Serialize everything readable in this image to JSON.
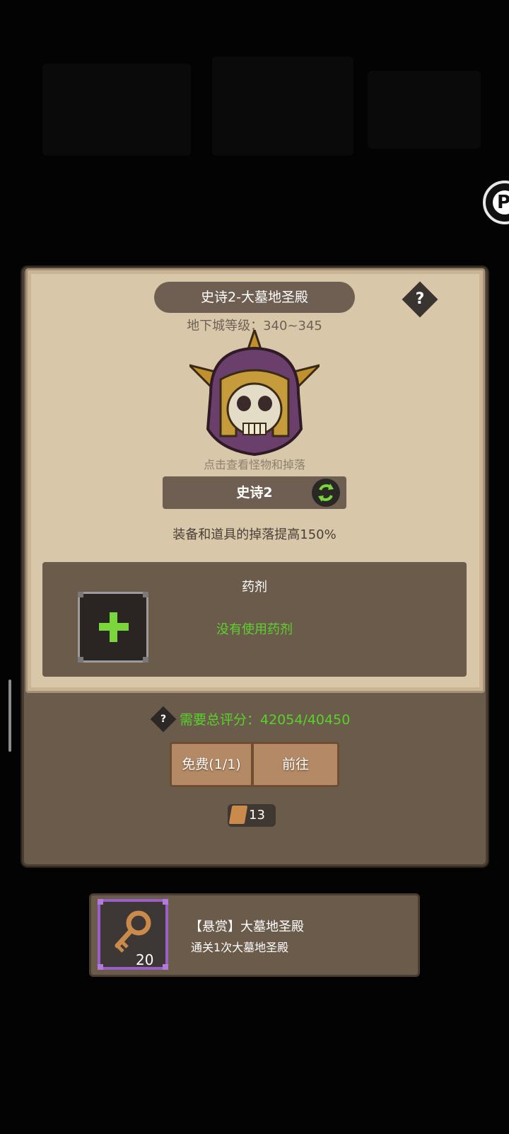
{
  "dungeon": {
    "title": "史诗2-大墓地圣殿",
    "level_text": "地下城等级：340~345",
    "monster_hint": "点击查看怪物和掉落",
    "difficulty": "史诗2",
    "drop_bonus": "装备和道具的掉落提高150%"
  },
  "potion": {
    "title": "药剂",
    "status": "没有使用药剂"
  },
  "score": {
    "text": "需要总评分：42054/40450"
  },
  "buttons": {
    "free": "免费(1/1)",
    "go": "前往"
  },
  "ticket": {
    "count": "13"
  },
  "quest": {
    "title": "【悬赏】大墓地圣殿",
    "description": "通关1次大墓地圣殿",
    "reward_count": "20"
  },
  "help_symbol": "?",
  "colors": {
    "accent_green": "#58d22b",
    "parchment": "#d8c7a9",
    "panel_brown": "#6b5b4b",
    "rarity_purple": "#9a5ec7"
  },
  "icons": [
    "help-icon",
    "monster-skull-helmet-icon",
    "refresh-icon",
    "plus-icon",
    "ticket-icon",
    "key-icon"
  ]
}
